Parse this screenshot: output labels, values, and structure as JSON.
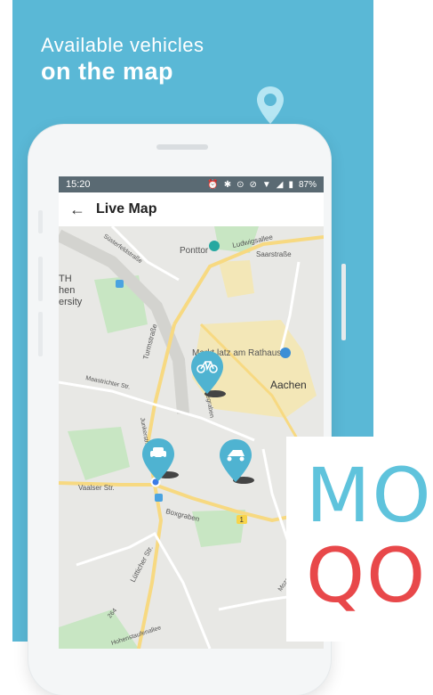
{
  "promo": {
    "line1": "Available vehicles",
    "line2": "on the map"
  },
  "status_bar": {
    "time": "15:20",
    "battery": "87%"
  },
  "app_bar": {
    "back_icon": "←",
    "title": "Live Map"
  },
  "map": {
    "labels": {
      "ponttor": "Ponttor",
      "ludwigsallee": "Ludwigsallee",
      "saarstrasse": "Saarstraße",
      "suesterfeldstrasse": "Süsterfeldstraße",
      "rwth_1": "TH",
      "rwth_2": "hen",
      "rwth_3": "ersity",
      "turmstrasse": "Turmstraße",
      "markt": "Markt",
      "platz_rathaus": "latz am Rathaus",
      "aachen": "Aachen",
      "maastrichter": "Maastrichter Str.",
      "karlsgraben": "Karlsgraben",
      "junkerstrasse": "Junkerstr.",
      "vaalser": "Vaalser Str.",
      "boxgraben": "Boxgraben",
      "luetticher": "Lütticher Str.",
      "route_264": "264",
      "route_1": "1",
      "hohenstaufenallee": "Hohenstaufenallee",
      "mozartstrasse": "Mozartstraße"
    },
    "markers": [
      {
        "vehicle": "bicycle-icon"
      },
      {
        "vehicle": "car-icon"
      },
      {
        "vehicle": "scooter-icon"
      }
    ]
  },
  "logo": {
    "top": "MO",
    "bottom": "QO"
  },
  "colors": {
    "panel_bg": "#5ab8d6",
    "marker": "#4fb3d1",
    "logo_blue": "#5fc3dc",
    "logo_red": "#e8484a"
  }
}
